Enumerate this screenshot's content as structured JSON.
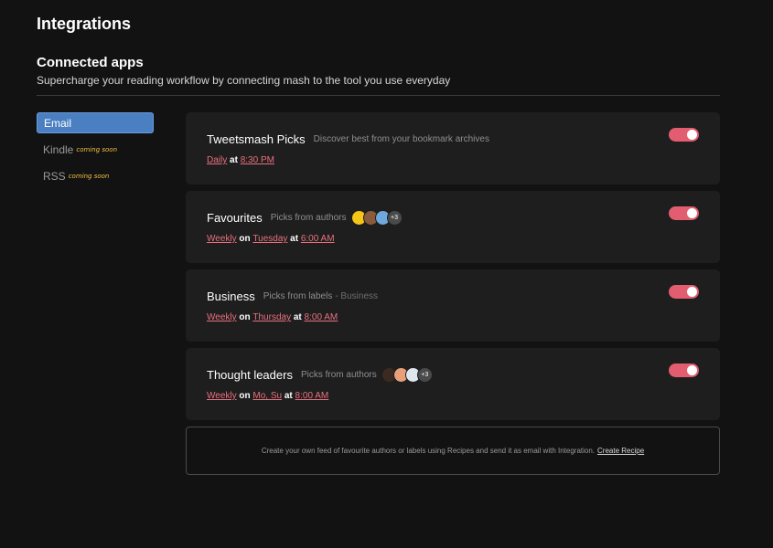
{
  "page": {
    "title": "Integrations",
    "section_title": "Connected apps",
    "section_subtitle": "Supercharge your reading workflow by connecting mash to the tool you use everyday"
  },
  "sidebar": {
    "items": [
      {
        "label": "Email",
        "badge": ""
      },
      {
        "label": "Kindle",
        "badge": "coming soon"
      },
      {
        "label": "RSS",
        "badge": "coming soon"
      }
    ]
  },
  "cards": [
    {
      "title": "Tweetsmash Picks",
      "description": "Discover best from your bookmark archives",
      "schedule": {
        "frequency": "Daily",
        "at": "at",
        "time": "8:30 PM"
      },
      "enabled": true
    },
    {
      "title": "Favourites",
      "description": "Picks from authors",
      "avatars_more": "+3",
      "schedule": {
        "frequency": "Weekly",
        "on": "on",
        "day": "Tuesday",
        "at": "at",
        "time": "6:00 AM"
      },
      "enabled": true
    },
    {
      "title": "Business",
      "description": "Picks from labels",
      "description_extra": "- Business",
      "schedule": {
        "frequency": "Weekly",
        "on": "on",
        "day": "Thursday",
        "at": "at",
        "time": "8:00 AM"
      },
      "enabled": true
    },
    {
      "title": "Thought leaders",
      "description": "Picks from authors",
      "avatars_more": "+3",
      "schedule": {
        "frequency": "Weekly",
        "on": "on",
        "day": "Mo, Su",
        "at": "at",
        "time": "8:00 AM"
      },
      "enabled": true
    }
  ],
  "recipe": {
    "text": "Create your own feed of favourite authors or labels using Recipes and send it as email with Integration.",
    "link": "Create Recipe"
  },
  "colors": {
    "background": "#121212",
    "card": "#1e1e1e",
    "accent_pink": "#e25d6f",
    "active_blue": "#4a7fc1",
    "badge_yellow": "#f5c542"
  }
}
